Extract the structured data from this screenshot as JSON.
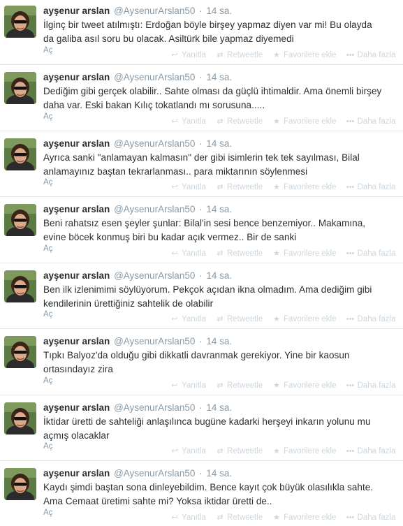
{
  "actions": {
    "reply": "Yanıtla",
    "retweet": "Retweetle",
    "favorite": "Favorilere ekle",
    "more": "Daha fazla",
    "expand": "Aç"
  },
  "icons": {
    "reply": "reply-arrow-icon",
    "retweet": "retweet-arrows-icon",
    "favorite": "star-icon",
    "more": "dots-icon"
  },
  "colors": {
    "name": "#292f33",
    "meta": "#8899a6",
    "action": "#ccd6dd",
    "divider": "#e8e8e8"
  },
  "tweets": [
    {
      "fullname": "ayşenur arslan",
      "username": "@AysenurArslan50",
      "separator": "·",
      "time": "14 sa.",
      "text": "İlginç bir tweet atılmıştı: Erdoğan böyle birşey yapmaz diyen var mi! Bu olayda\nda galiba asıl soru bu olacak. Asiltürk bile yapmaz diyemedi"
    },
    {
      "fullname": "ayşenur arslan",
      "username": "@AysenurArslan50",
      "separator": "·",
      "time": "14 sa.",
      "text": "Dediğim gibi gerçek olabilir.. Sahte olması da güçlü ihtimaldir. Ama önemli birşey\ndaha var. Eski bakan Kılıç tokatlandı mı sorusuna....."
    },
    {
      "fullname": "ayşenur arslan",
      "username": "@AysenurArslan50",
      "separator": "·",
      "time": "14 sa.",
      "text": "Ayrıca sanki \"anlamayan kalmasın\" der gibi isimlerin tek tek sayılması, Bilal\nanlamayınız baştan tekrarlanması.. para miktarının söylenmesi"
    },
    {
      "fullname": "ayşenur arslan",
      "username": "@AysenurArslan50",
      "separator": "·",
      "time": "14 sa.",
      "text": "Beni rahatsız esen şeyler şunlar: Bilal'in sesi bence benzemiyor.. Makamına,\nevine böcek konmuş biri bu kadar açık vermez.. Bir de sanki"
    },
    {
      "fullname": "ayşenur arslan",
      "username": "@AysenurArslan50",
      "separator": "·",
      "time": "14 sa.",
      "text": "Ben ilk izlenimimi söylüyorum. Pekçok açıdan ikna olmadım. Ama dediğim gibi\nkendilerinin ürettiğiniz sahtelik de olabilir"
    },
    {
      "fullname": "ayşenur arslan",
      "username": "@AysenurArslan50",
      "separator": "·",
      "time": "14 sa.",
      "text": "Tıpkı Balyoz'da olduğu gibi dikkatli davranmak gerekiyor. Yine bir kaosun\nortasındayız zira"
    },
    {
      "fullname": "ayşenur arslan",
      "username": "@AysenurArslan50",
      "separator": "·",
      "time": "14 sa.",
      "text": "İktidar üretti de sahteliği anlaşılınca bugüne kadarki herşeyi inkarın yolunu mu\naçmış olacaklar"
    },
    {
      "fullname": "ayşenur arslan",
      "username": "@AysenurArslan50",
      "separator": "·",
      "time": "14 sa.",
      "text": "Kaydı şimdi baştan sona dinleyebildim. Bence kayıt çok büyük olasılıkla sahte.\nAma Cemaat üretimi sahte mi? Yoksa iktidar üretti de.."
    }
  ]
}
